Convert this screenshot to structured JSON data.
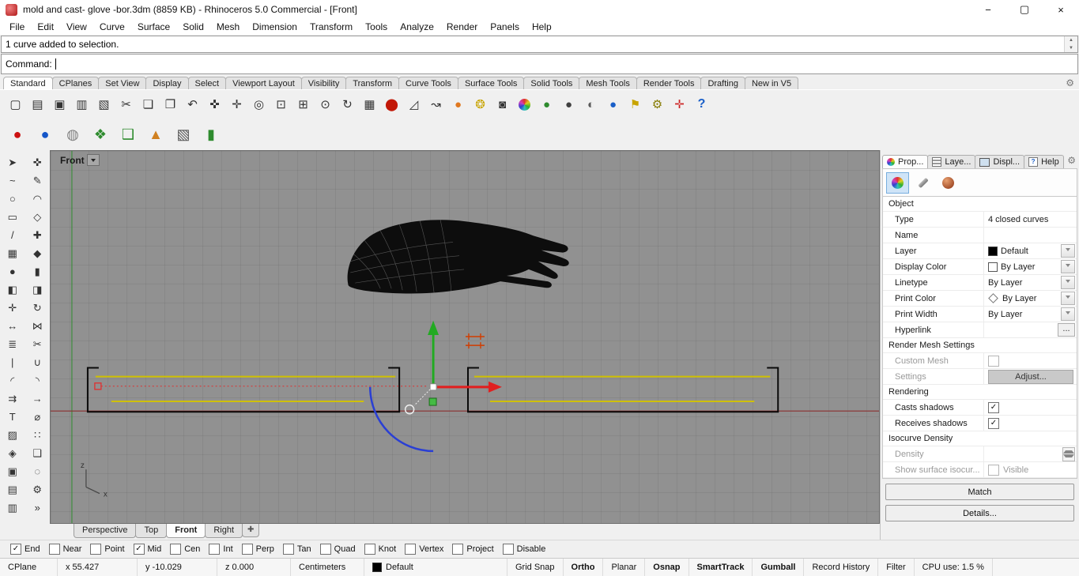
{
  "window": {
    "title": "mold and cast- glove -bor.3dm (8859 KB) - Rhinoceros 5.0 Commercial - [Front]",
    "minimize": "−",
    "maximize": "▢",
    "close": "×"
  },
  "menu": {
    "items": [
      {
        "label": "File"
      },
      {
        "label": "Edit"
      },
      {
        "label": "View"
      },
      {
        "label": "Curve"
      },
      {
        "label": "Surface"
      },
      {
        "label": "Solid"
      },
      {
        "label": "Mesh"
      },
      {
        "label": "Dimension"
      },
      {
        "label": "Transform"
      },
      {
        "label": "Tools"
      },
      {
        "label": "Analyze"
      },
      {
        "label": "Render"
      },
      {
        "label": "Panels"
      },
      {
        "label": "Help"
      }
    ]
  },
  "command": {
    "history_line": "1 curve added to selection.",
    "prompt": "Command:"
  },
  "toolbar_tabs": {
    "items": [
      {
        "label": "Standard",
        "active": true
      },
      {
        "label": "CPlanes"
      },
      {
        "label": "Set View"
      },
      {
        "label": "Display"
      },
      {
        "label": "Select"
      },
      {
        "label": "Viewport Layout"
      },
      {
        "label": "Visibility"
      },
      {
        "label": "Transform"
      },
      {
        "label": "Curve Tools"
      },
      {
        "label": "Surface Tools"
      },
      {
        "label": "Solid Tools"
      },
      {
        "label": "Mesh Tools"
      },
      {
        "label": "Render Tools"
      },
      {
        "label": "Drafting"
      },
      {
        "label": "New in V5"
      }
    ]
  },
  "toolbar1": {
    "items": [
      {
        "name": "new-file-icon",
        "glyph": "▢"
      },
      {
        "name": "open-file-icon",
        "glyph": "▤"
      },
      {
        "name": "save-icon",
        "glyph": "▣"
      },
      {
        "name": "print-icon",
        "glyph": "▥"
      },
      {
        "name": "export-icon",
        "glyph": "▧"
      },
      {
        "name": "cut-icon",
        "glyph": "✂"
      },
      {
        "name": "copy-icon",
        "glyph": "❏"
      },
      {
        "name": "paste-icon",
        "glyph": "❐"
      },
      {
        "name": "undo-icon",
        "glyph": "↶"
      },
      {
        "name": "pan-icon",
        "glyph": "✜"
      },
      {
        "name": "move-icon",
        "glyph": "✛"
      },
      {
        "name": "zoom-icon",
        "glyph": "◎"
      },
      {
        "name": "zoom-window-icon",
        "glyph": "⊡"
      },
      {
        "name": "zoom-extents-icon",
        "glyph": "⊞"
      },
      {
        "name": "zoom-selected-icon",
        "glyph": "⊙"
      },
      {
        "name": "rotate-view-icon",
        "glyph": "↻"
      },
      {
        "name": "viewport-layout-icon",
        "glyph": "▦"
      },
      {
        "name": "car-icon",
        "glyph": "⬤",
        "color": "#c21807"
      },
      {
        "name": "shear-icon",
        "glyph": "◿"
      },
      {
        "name": "orient-icon",
        "glyph": "↝"
      },
      {
        "name": "point-icon",
        "glyph": "●",
        "color": "#e07820"
      },
      {
        "name": "lamp-icon",
        "glyph": "❂",
        "color": "#c8a400"
      },
      {
        "name": "lock-icon",
        "glyph": "◙"
      },
      {
        "name": "render-icon",
        "glyph": "",
        "cls": "rainbow"
      },
      {
        "name": "shaded-green-sphere-icon",
        "glyph": "●",
        "color": "#2e8b2e"
      },
      {
        "name": "shaded-sphere-icon",
        "glyph": "●",
        "color": "#404040"
      },
      {
        "name": "ghosted-sphere-icon",
        "glyph": "◐",
        "color": "#5a5a5a"
      },
      {
        "name": "render-blue-sphere-icon",
        "glyph": "●",
        "color": "#1a5fc8"
      },
      {
        "name": "flag-icon",
        "glyph": "⚑",
        "color": "#c8a400"
      },
      {
        "name": "gears-icon",
        "glyph": "⚙",
        "color": "#857a00"
      },
      {
        "name": "gumball-tool-icon",
        "glyph": "✛",
        "color": "#cc2222"
      },
      {
        "name": "help-icon",
        "glyph": "?",
        "cls": "help"
      }
    ]
  },
  "toolbar2": {
    "items": [
      {
        "name": "render-sphere-red-icon",
        "glyph": "●",
        "color": "#cc1111"
      },
      {
        "name": "render-sphere-blue-icon",
        "glyph": "●",
        "color": "#1556c8"
      },
      {
        "name": "flat-shade-icon",
        "glyph": "◍",
        "color": "#808080"
      },
      {
        "name": "shade-selected-icon",
        "glyph": "❖",
        "color": "#2e8b2e"
      },
      {
        "name": "shade-mesh-icon",
        "glyph": "❑",
        "color": "#2e8b2e"
      },
      {
        "name": "cone-icon",
        "glyph": "▲",
        "color": "#d08020"
      },
      {
        "name": "selection-filter-icon",
        "glyph": "▧",
        "color": "#555555"
      },
      {
        "name": "cylinder-icon",
        "glyph": "▮",
        "color": "#2e8b2e"
      }
    ]
  },
  "sidebar": {
    "items": [
      {
        "name": "select-arrow-icon",
        "glyph": "➤"
      },
      {
        "name": "point-tool-icon",
        "glyph": "✜"
      },
      {
        "name": "curve-tool-icon",
        "glyph": "~"
      },
      {
        "name": "pencil-tool-icon",
        "glyph": "✎"
      },
      {
        "name": "circle-tool-icon",
        "glyph": "○"
      },
      {
        "name": "arc-tool-icon",
        "glyph": "◠"
      },
      {
        "name": "rectangle-tool-icon",
        "glyph": "▭"
      },
      {
        "name": "polygon-tool-icon",
        "glyph": "◇"
      },
      {
        "name": "line-tool-icon",
        "glyph": "/"
      },
      {
        "name": "plus-point-icon",
        "glyph": "✚"
      },
      {
        "name": "surface-tool-icon",
        "glyph": "▦"
      },
      {
        "name": "solid-tool-icon",
        "glyph": "◆"
      },
      {
        "name": "sphere-tool-icon",
        "glyph": "●"
      },
      {
        "name": "cylinder-tool-icon",
        "glyph": "▮"
      },
      {
        "name": "boolean-union-icon",
        "glyph": "◧"
      },
      {
        "name": "boolean-diff-icon",
        "glyph": "◨"
      },
      {
        "name": "move-tool-icon",
        "glyph": "✛"
      },
      {
        "name": "rotate-tool-icon",
        "glyph": "↻"
      },
      {
        "name": "scale-tool-icon",
        "glyph": "↔"
      },
      {
        "name": "mirror-tool-icon",
        "glyph": "⋈"
      },
      {
        "name": "array-tool-icon",
        "glyph": "≣"
      },
      {
        "name": "trim-tool-icon",
        "glyph": "✂"
      },
      {
        "name": "split-tool-icon",
        "glyph": "|"
      },
      {
        "name": "join-tool-icon",
        "glyph": "∪"
      },
      {
        "name": "fillet-tool-icon",
        "glyph": "◜"
      },
      {
        "name": "chamfer-tool-icon",
        "glyph": "◝"
      },
      {
        "name": "offset-tool-icon",
        "glyph": "⇉"
      },
      {
        "name": "extend-tool-icon",
        "glyph": "→"
      },
      {
        "name": "text-tool-icon",
        "glyph": "T"
      },
      {
        "name": "dimension-tool-icon",
        "glyph": "⌀"
      },
      {
        "name": "hatch-tool-icon",
        "glyph": "▨"
      },
      {
        "name": "points-tool-icon",
        "glyph": "∷"
      },
      {
        "name": "block-tool-icon",
        "glyph": "◈"
      },
      {
        "name": "group-tool-icon",
        "glyph": "❑"
      },
      {
        "name": "visibility-tool-icon",
        "glyph": "▣"
      },
      {
        "name": "hide-tool-icon",
        "glyph": "◌"
      },
      {
        "name": "layers-tool-icon",
        "glyph": "▤"
      },
      {
        "name": "settings-tool-icon",
        "glyph": "⚙"
      },
      {
        "name": "more-tools-icon",
        "glyph": "▥"
      },
      {
        "name": "expand-tools-icon",
        "glyph": "»"
      }
    ]
  },
  "viewport": {
    "label": "Front",
    "axis_z": "z",
    "axis_x": "x"
  },
  "viewport_tabs": {
    "items": [
      {
        "label": "Perspective"
      },
      {
        "label": "Top"
      },
      {
        "label": "Front",
        "active": true
      },
      {
        "label": "Right"
      },
      {
        "label": "✚",
        "cls": "paneicon",
        "name": "new-viewport-icon"
      }
    ]
  },
  "panel": {
    "tab_prop": "Prop...",
    "tab_layers": "Laye...",
    "tab_display": "Displ...",
    "tab_help": "Help",
    "object_header": "Object",
    "type_label": "Type",
    "type_value": "4 closed curves",
    "name_label": "Name",
    "layer_label": "Layer",
    "layer_value": "Default",
    "display_color_label": "Display Color",
    "display_color_value": "By Layer",
    "linetype_label": "Linetype",
    "linetype_value": "By Layer",
    "print_color_label": "Print Color",
    "print_color_value": "By Layer",
    "print_width_label": "Print Width",
    "print_width_value": "By Layer",
    "hyperlink_label": "Hyperlink",
    "hyperlink_button": "...",
    "render_mesh_header": "Render Mesh Settings",
    "custom_mesh_label": "Custom Mesh",
    "settings_label": "Settings",
    "adjust_button": "Adjust...",
    "rendering_header": "Rendering",
    "casts_shadows_label": "Casts shadows",
    "receives_shadows_label": "Receives shadows",
    "isocurve_header": "Isocurve Density",
    "density_label": "Density",
    "show_isocurve_label": "Show surface isocur...",
    "visible_label": "Visible",
    "match_button": "Match",
    "details_button": "Details..."
  },
  "osnap": {
    "items": [
      {
        "label": "End",
        "checked": true
      },
      {
        "label": "Near"
      },
      {
        "label": "Point"
      },
      {
        "label": "Mid",
        "checked": true
      },
      {
        "label": "Cen"
      },
      {
        "label": "Int"
      },
      {
        "label": "Perp"
      },
      {
        "label": "Tan"
      },
      {
        "label": "Quad"
      },
      {
        "label": "Knot"
      },
      {
        "label": "Vertex"
      },
      {
        "label": "Project"
      },
      {
        "label": "Disable"
      }
    ]
  },
  "status": {
    "items": [
      {
        "label": "CPlane",
        "cls": "w60"
      },
      {
        "label": "x 55.427",
        "cls": "w88"
      },
      {
        "label": "y -10.029",
        "cls": "w88"
      },
      {
        "label": "z 0.000",
        "cls": "w80"
      },
      {
        "label": "Centimeters",
        "cls": "w80"
      },
      {
        "label": "Default",
        "swatch": true,
        "cls": "w170"
      },
      {
        "label": "Grid Snap"
      },
      {
        "label": "Ortho",
        "bold": true
      },
      {
        "label": "Planar"
      },
      {
        "label": "Osnap",
        "bold": true
      },
      {
        "label": "SmartTrack",
        "bold": true
      },
      {
        "label": "Gumball",
        "bold": true
      },
      {
        "label": "Record History"
      },
      {
        "label": "Filter"
      },
      {
        "label": "CPU use: 1.5 %"
      }
    ]
  }
}
